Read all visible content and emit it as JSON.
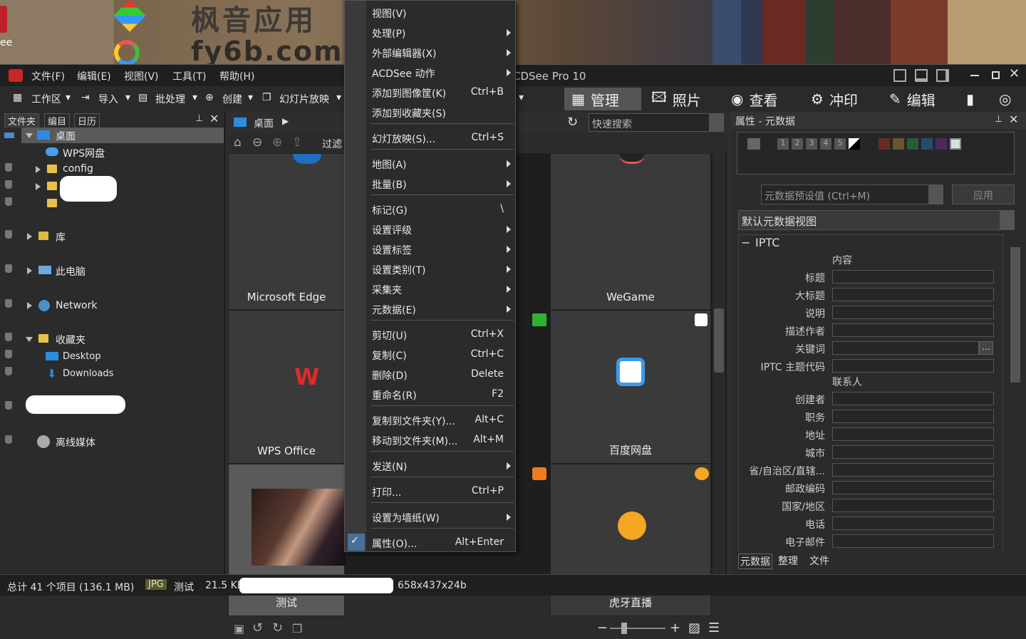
{
  "desktop": {
    "watermark1": "枫音应用",
    "watermark2": "fy6b.com",
    "left_icon_label": "ee"
  },
  "window": {
    "title": "ACDSee Pro 10",
    "title_visible": "CDSee Pro 10"
  },
  "menubar": [
    "文件(F)",
    "编辑(E)",
    "视图(V)",
    "工具(T)",
    "帮助(H)"
  ],
  "toolbar": {
    "workspace": "工作区",
    "import": "导入",
    "batch": "批处理",
    "create": "创建",
    "slideshow": "幻灯片放映"
  },
  "modes": [
    "管理",
    "照片",
    "查看",
    "冲印",
    "编辑"
  ],
  "leftpane": {
    "tabs": [
      "文件夹",
      "编目",
      "日历"
    ],
    "tree": [
      "桌面",
      "WPS网盘",
      "config",
      "库",
      "此电脑",
      "Network",
      "收藏夹",
      "Desktop",
      "Downloads",
      "离线媒体"
    ]
  },
  "center": {
    "path": "桌面",
    "filter": "过滤",
    "search_placeholder": "快速搜索",
    "cells": [
      "Microsoft Edge",
      "WeGame",
      "WPS Office",
      "百度网盘",
      "测试",
      "虎牙直播"
    ]
  },
  "context_menu": [
    {
      "label": "视图(V)",
      "shortcut": "",
      "sub": false
    },
    {
      "label": "处理(P)",
      "shortcut": "",
      "sub": true
    },
    {
      "label": "外部编辑器(X)",
      "shortcut": "",
      "sub": true
    },
    {
      "label": "ACDSee 动作",
      "shortcut": "",
      "sub": true
    },
    {
      "label": "添加到图像筐(K)",
      "shortcut": "Ctrl+B",
      "sub": false
    },
    {
      "label": "添加到收藏夹(S)",
      "shortcut": "",
      "sub": false
    },
    {
      "label": "幻灯放映(S)...",
      "shortcut": "Ctrl+S",
      "sub": false
    },
    {
      "label": "地图(A)",
      "shortcut": "",
      "sub": true
    },
    {
      "label": "批量(B)",
      "shortcut": "",
      "sub": true
    },
    {
      "label": "标记(G)",
      "shortcut": "\\",
      "sub": false
    },
    {
      "label": "设置评级",
      "shortcut": "",
      "sub": true
    },
    {
      "label": "设置标签",
      "shortcut": "",
      "sub": true
    },
    {
      "label": "设置类别(T)",
      "shortcut": "",
      "sub": true
    },
    {
      "label": "采集夹",
      "shortcut": "",
      "sub": true
    },
    {
      "label": "元数据(E)",
      "shortcut": "",
      "sub": true
    },
    {
      "label": "剪切(U)",
      "shortcut": "Ctrl+X",
      "sub": false
    },
    {
      "label": "复制(C)",
      "shortcut": "Ctrl+C",
      "sub": false
    },
    {
      "label": "删除(D)",
      "shortcut": "Delete",
      "sub": false
    },
    {
      "label": "重命名(R)",
      "shortcut": "F2",
      "sub": false
    },
    {
      "label": "复制到文件夹(Y)...",
      "shortcut": "Alt+C",
      "sub": false
    },
    {
      "label": "移动到文件夹(M)...",
      "shortcut": "Alt+M",
      "sub": false
    },
    {
      "label": "发送(N)",
      "shortcut": "",
      "sub": true
    },
    {
      "label": "打印...",
      "shortcut": "Ctrl+P",
      "sub": false
    },
    {
      "label": "设置为墙纸(W)",
      "shortcut": "",
      "sub": true
    },
    {
      "label": "属性(O)...",
      "shortcut": "Alt+Enter",
      "sub": false
    }
  ],
  "rightpane": {
    "title": "属性 - 元数据",
    "ratings": [
      "1",
      "2",
      "3",
      "4",
      "5"
    ],
    "preset_placeholder": "元数据预设值 (Ctrl+M)",
    "apply": "应用",
    "view": "默认元数据视图",
    "section": "IPTC",
    "group1": "内容",
    "fields1": [
      "标题",
      "大标题",
      "说明",
      "描述作者",
      "关键词",
      "IPTC 主题代码"
    ],
    "group2": "联系人",
    "fields2": [
      "创建者",
      "职务",
      "地址",
      "城市",
      "省/自治区/直辖...",
      "邮政编码",
      "国家/地区",
      "电话",
      "电子邮件"
    ],
    "bottom_tabs": [
      "元数据",
      "整理",
      "文件"
    ]
  },
  "status": {
    "total": "总计 41 个项目 (136.1 MB)",
    "type": "JPG",
    "name": "测试",
    "size": "21.5 KB",
    "dims": "658x437x24b"
  },
  "colors": {
    "accent": "#4a8bd0",
    "window_bg": "#2e2e2e",
    "active_mode": "#555555"
  }
}
